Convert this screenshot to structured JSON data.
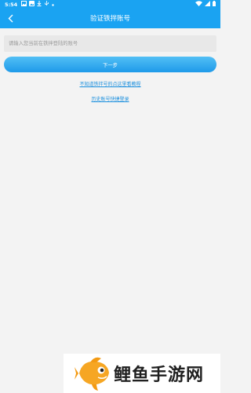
{
  "status_bar": {
    "time": "5:54",
    "icons_left": [
      "photo-icon",
      "gallery-icon",
      "download-icon",
      "usb-icon",
      "dot-icon"
    ],
    "icons_right": [
      "wifi-icon",
      "signal-icon",
      "battery-icon"
    ]
  },
  "nav": {
    "title": "验证铁拌账号",
    "back_icon": "chevron-left-icon"
  },
  "form": {
    "input_value": "",
    "input_placeholder": "请输入您当前在铁拌登陆的账号",
    "next_label": "下一步"
  },
  "links": {
    "tutorial": "不知道铁拌号的点这里看教程",
    "history": "历史账号快捷登录"
  },
  "watermark": {
    "text": "鲤鱼手游网"
  },
  "colors": {
    "header": "#1aa3f2",
    "button": "#2aa6ee",
    "link": "#1a8fde",
    "background": "#f3f3f3"
  }
}
